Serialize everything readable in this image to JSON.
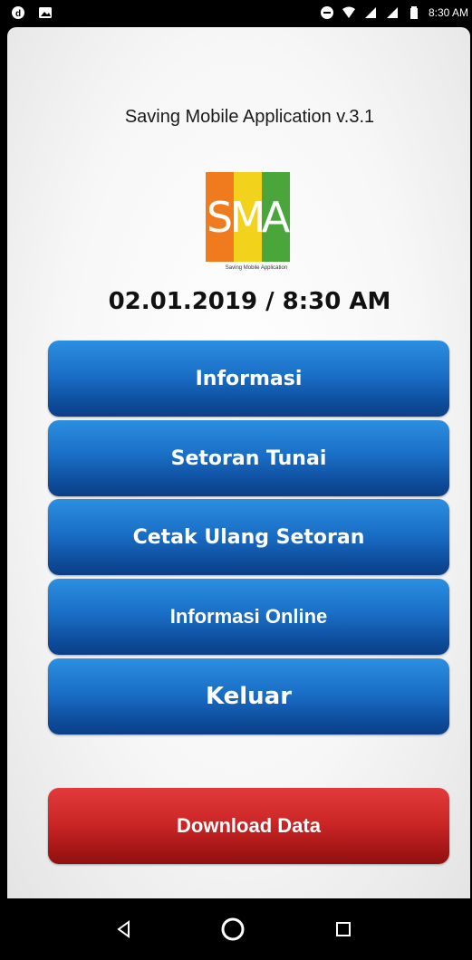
{
  "status_bar": {
    "time": "8:30 AM",
    "left_icons": [
      "notification-icon",
      "image-icon"
    ],
    "right_icons": [
      "do-not-disturb-icon",
      "wifi-icon",
      "signal-icon",
      "signal-icon",
      "battery-icon"
    ]
  },
  "app": {
    "title": "Saving Mobile Application v.3.1",
    "logo": {
      "letters": [
        "S",
        "M",
        "A"
      ],
      "colors": [
        "#f07a1e",
        "#f2d21a",
        "#4aa63a"
      ],
      "subtitle": "Saving Mobile Application"
    },
    "datetime": "02.01.2019 / 8:30 AM"
  },
  "menu": {
    "buttons": [
      {
        "label": "Informasi"
      },
      {
        "label": "Setoran Tunai"
      },
      {
        "label": "Cetak Ulang Setoran"
      },
      {
        "label": "Informasi Online"
      },
      {
        "label": "Keluar"
      }
    ],
    "download_label": "Download Data"
  },
  "colors": {
    "button_blue": "#1a6fc7",
    "button_red": "#cc2727",
    "background": "#f5f5f5"
  },
  "nav_bar": {
    "items": [
      "back-icon",
      "home-icon",
      "recents-icon"
    ]
  }
}
